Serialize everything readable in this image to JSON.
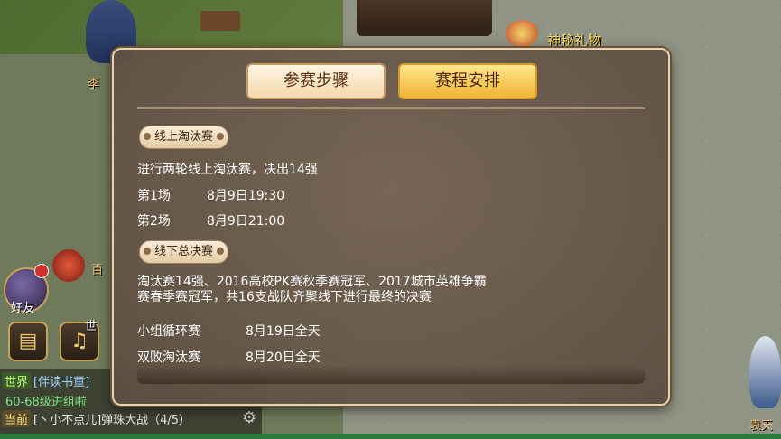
{
  "world": {
    "npcs": [
      {
        "name": "神秘礼物"
      },
      {
        "name": "李"
      },
      {
        "name": "百"
      },
      {
        "name": "袁天"
      }
    ]
  },
  "hud": {
    "friends_label": "好友",
    "world_label": "世",
    "chat_icon": "speech-bubble-icon",
    "voice_icon": "microphone-icon"
  },
  "chat": {
    "lines": [
      {
        "channel": "世界",
        "text": "[伴读书童]",
        "color": "#9fd0ff"
      },
      {
        "channel": "",
        "text": "60-68级进组啦",
        "color": "#7fe37f"
      },
      {
        "channel": "当前",
        "text": "[丶小不点儿]弹珠大战（4/5）",
        "color": "#e6e6e6"
      }
    ]
  },
  "dialog": {
    "tabs": [
      {
        "label": "参赛步骤",
        "active": false
      },
      {
        "label": "赛程安排",
        "active": true
      }
    ],
    "sections": [
      {
        "title": "线上淘汰赛",
        "description": "进行两轮线上淘汰赛，决出14强",
        "rows": [
          {
            "name": "第1场",
            "time": "8月9日19:30"
          },
          {
            "name": "第2场",
            "time": "8月9日21:00"
          }
        ]
      },
      {
        "title": "线下总决赛",
        "description_line1": "淘汰赛14强、2016高校PK赛秋季赛冠军、2017城市英雄争霸",
        "description_line2": "赛春季赛冠军，共16支战队齐聚线下进行最终的决赛",
        "rows": [
          {
            "name": "小组循环赛",
            "time": "8月19日全天"
          },
          {
            "name": "双败淘汰赛",
            "time": "8月20日全天"
          }
        ]
      }
    ]
  },
  "colors": {
    "active_tab": "#f1b534",
    "dialog_border": "#e7d3ae",
    "dialog_bg": "#6e5e4e"
  }
}
